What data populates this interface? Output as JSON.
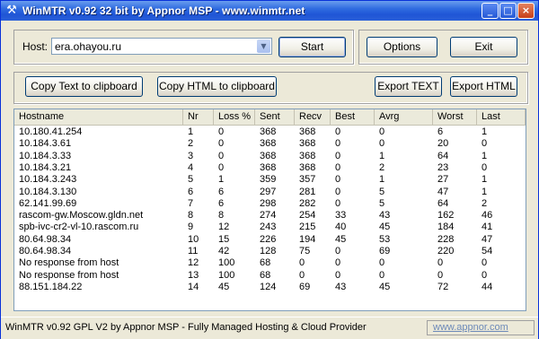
{
  "window": {
    "title": "WinMTR v0.92 32 bit by Appnor MSP - www.winmtr.net",
    "icon": "winmtr-icon",
    "controls": [
      "_",
      "□",
      "×"
    ]
  },
  "host": {
    "label": "Host:",
    "value": "era.ohayou.ru",
    "start_label": "Start"
  },
  "options": {
    "options_label": "Options",
    "exit_label": "Exit"
  },
  "toolbar": {
    "copy_text": "Copy Text to clipboard",
    "copy_html": "Copy HTML to clipboard",
    "export_text": "Export TEXT",
    "export_html": "Export HTML"
  },
  "table": {
    "columns": [
      "Hostname",
      "Nr",
      "Loss %",
      "Sent",
      "Recv",
      "Best",
      "Avrg",
      "Worst",
      "Last"
    ],
    "rows": [
      [
        "10.180.41.254",
        "1",
        "0",
        "368",
        "368",
        "0",
        "0",
        "6",
        "1"
      ],
      [
        "10.184.3.61",
        "2",
        "0",
        "368",
        "368",
        "0",
        "0",
        "20",
        "0"
      ],
      [
        "10.184.3.33",
        "3",
        "0",
        "368",
        "368",
        "0",
        "1",
        "64",
        "1"
      ],
      [
        "10.184.3.21",
        "4",
        "0",
        "368",
        "368",
        "0",
        "2",
        "23",
        "0"
      ],
      [
        "10.184.3.243",
        "5",
        "1",
        "359",
        "357",
        "0",
        "1",
        "27",
        "1"
      ],
      [
        "10.184.3.130",
        "6",
        "6",
        "297",
        "281",
        "0",
        "5",
        "47",
        "1"
      ],
      [
        "62.141.99.69",
        "7",
        "6",
        "298",
        "282",
        "0",
        "5",
        "64",
        "2"
      ],
      [
        "rascom-gw.Moscow.gldn.net",
        "8",
        "8",
        "274",
        "254",
        "33",
        "43",
        "162",
        "46"
      ],
      [
        "spb-ivc-cr2-vl-10.rascom.ru",
        "9",
        "12",
        "243",
        "215",
        "40",
        "45",
        "184",
        "41"
      ],
      [
        "80.64.98.34",
        "10",
        "15",
        "226",
        "194",
        "45",
        "53",
        "228",
        "47"
      ],
      [
        "80.64.98.34",
        "11",
        "42",
        "128",
        "75",
        "0",
        "69",
        "220",
        "54"
      ],
      [
        "No response from host",
        "12",
        "100",
        "68",
        "0",
        "0",
        "0",
        "0",
        "0"
      ],
      [
        "No response from host",
        "13",
        "100",
        "68",
        "0",
        "0",
        "0",
        "0",
        "0"
      ],
      [
        "88.151.184.22",
        "14",
        "45",
        "124",
        "69",
        "43",
        "45",
        "72",
        "44"
      ]
    ]
  },
  "status": {
    "text": "WinMTR v0.92 GPL V2 by Appnor MSP - Fully Managed Hosting & Cloud Provider",
    "link": "www.appnor.com"
  },
  "colors": {
    "titlebar": "#2f6be0",
    "face": "#ece9d8",
    "link": "#6d8ab9"
  }
}
